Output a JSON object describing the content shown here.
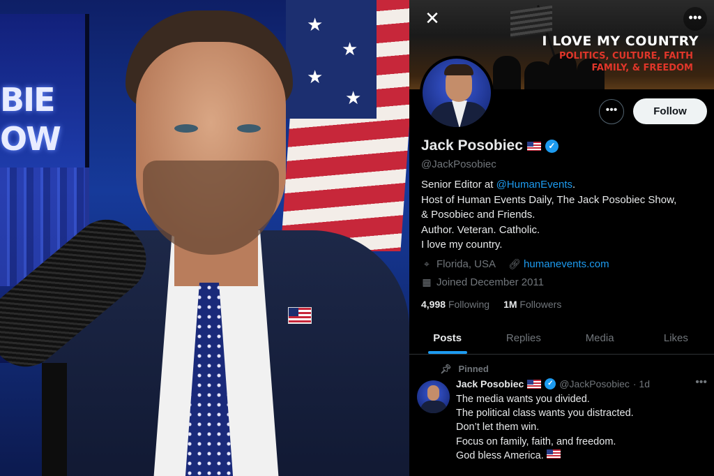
{
  "profile": {
    "banner": {
      "title": "I LOVE MY COUNTRY",
      "subtitle_line1": "POLITICS, CULTURE, FAITH",
      "subtitle_line2": "FAMILY, & FREEDOM"
    },
    "close_label": "✕",
    "more_label": "•••",
    "follow_label": "Follow",
    "display_name": "Jack Posobiec",
    "handle": "@JackPosobiec",
    "bio": {
      "line1_prefix": "Senior Editor at ",
      "line1_link": "@HumanEvents",
      "line1_suffix": ".",
      "line2": "Host of Human Events Daily, The Jack Posobiec Show,",
      "line3": "& Posobiec and Friends.",
      "line4": "Author. Veteran. Catholic.",
      "line5": "I love my country."
    },
    "location": "Florida, USA",
    "website": "humanevents.com",
    "joined": "Joined December 2011",
    "following_count": "4,998",
    "following_label": "Following",
    "followers_count": "1M",
    "followers_label": "Followers",
    "tabs": [
      "Posts",
      "Replies",
      "Media",
      "Likes"
    ],
    "active_tab": "Posts"
  },
  "pinned_post": {
    "pinned_label": "Pinned",
    "author_name": "Jack Posobiec",
    "author_handle": "@JackPosobiec",
    "time": "· 1d",
    "lines": [
      "The media wants you divided.",
      "The political class wants you distracted.",
      "Don’t let them win.",
      "Focus on family, faith, and freedom.",
      "God bless America."
    ]
  },
  "photo": {
    "studio_text": "BIE\nOW"
  },
  "colors": {
    "accent": "#1d9bf0",
    "background": "#000000",
    "text_primary": "#e7e9ea",
    "text_secondary": "#71767b",
    "banner_red": "#e0362a"
  },
  "icons": [
    "close-icon",
    "more-icon",
    "verified-icon",
    "location-icon",
    "link-icon",
    "calendar-icon",
    "pin-icon",
    "us-flag-icon"
  ]
}
